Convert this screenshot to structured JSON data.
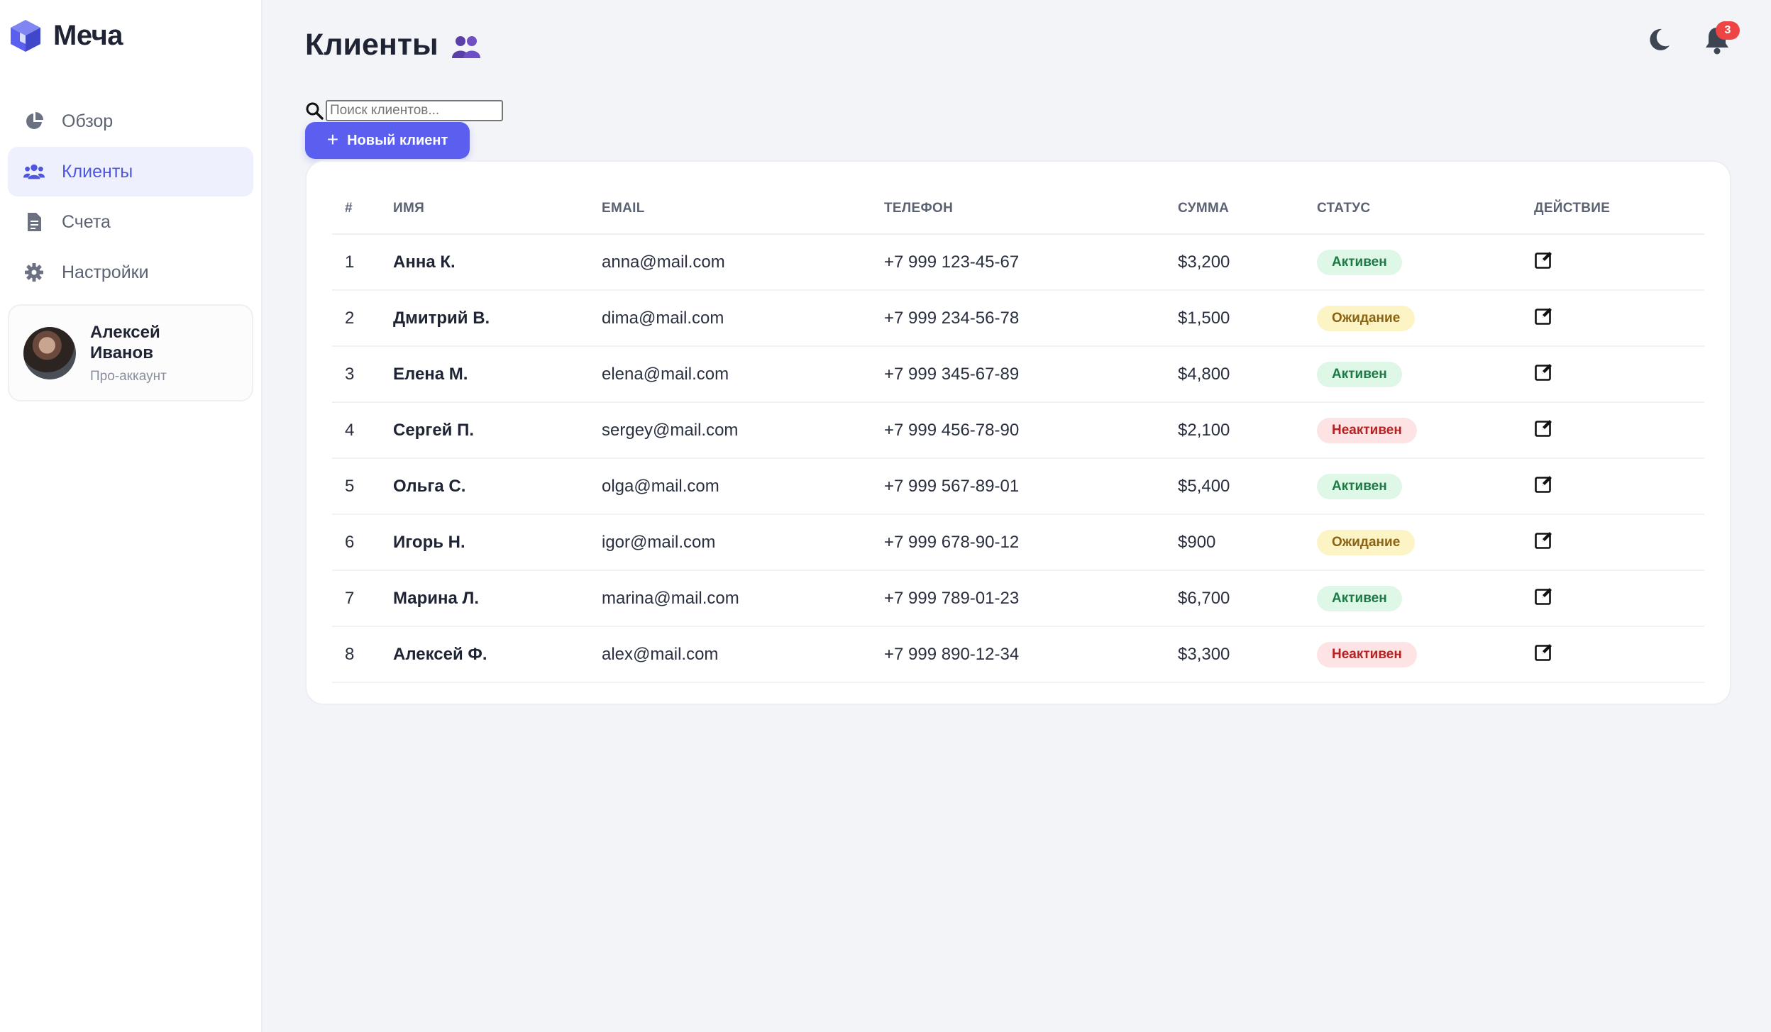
{
  "brand": {
    "name": "Меча",
    "accent": "#5b5ff0"
  },
  "sidebar": {
    "items": [
      {
        "label": "Обзор",
        "icon": "pie-chart-icon",
        "active": false
      },
      {
        "label": "Клиенты",
        "icon": "users-icon",
        "active": true
      },
      {
        "label": "Счета",
        "icon": "document-icon",
        "active": false
      },
      {
        "label": "Настройки",
        "icon": "gear-icon",
        "active": false
      }
    ],
    "profile": {
      "name": "Алексей Иванов",
      "subtitle": "Про-аккаунт"
    }
  },
  "header": {
    "title": "Клиенты",
    "title_icon": "users-group-icon",
    "notifications_count": "3"
  },
  "search": {
    "placeholder": "Поиск клиентов...",
    "value": ""
  },
  "new_client_button": {
    "label": "Новый клиент"
  },
  "table": {
    "columns": [
      "#",
      "ИМЯ",
      "EMAIL",
      "ТЕЛЕФОН",
      "СУММА",
      "СТАТУС",
      "ДЕЙСТВИЕ"
    ],
    "rows": [
      {
        "num": "1",
        "name": "Анна К.",
        "email": "anna@mail.com",
        "phone": "+7 999 123-45-67",
        "sum": "$3,200",
        "status": "Активен",
        "status_type": "active"
      },
      {
        "num": "2",
        "name": "Дмитрий В.",
        "email": "dima@mail.com",
        "phone": "+7 999 234-56-78",
        "sum": "$1,500",
        "status": "Ожидание",
        "status_type": "wait"
      },
      {
        "num": "3",
        "name": "Елена М.",
        "email": "elena@mail.com",
        "phone": "+7 999 345-67-89",
        "sum": "$4,800",
        "status": "Активен",
        "status_type": "active"
      },
      {
        "num": "4",
        "name": "Сергей П.",
        "email": "sergey@mail.com",
        "phone": "+7 999 456-78-90",
        "sum": "$2,100",
        "status": "Неактивен",
        "status_type": "inactive"
      },
      {
        "num": "5",
        "name": "Ольга С.",
        "email": "olga@mail.com",
        "phone": "+7 999 567-89-01",
        "sum": "$5,400",
        "status": "Активен",
        "status_type": "active"
      },
      {
        "num": "6",
        "name": "Игорь Н.",
        "email": "igor@mail.com",
        "phone": "+7 999 678-90-12",
        "sum": "$900",
        "status": "Ожидание",
        "status_type": "wait"
      },
      {
        "num": "7",
        "name": "Марина Л.",
        "email": "marina@mail.com",
        "phone": "+7 999 789-01-23",
        "sum": "$6,700",
        "status": "Активен",
        "status_type": "active"
      },
      {
        "num": "8",
        "name": "Алексей Ф.",
        "email": "alex@mail.com",
        "phone": "+7 999 890-12-34",
        "sum": "$3,300",
        "status": "Неактивен",
        "status_type": "inactive"
      }
    ]
  }
}
